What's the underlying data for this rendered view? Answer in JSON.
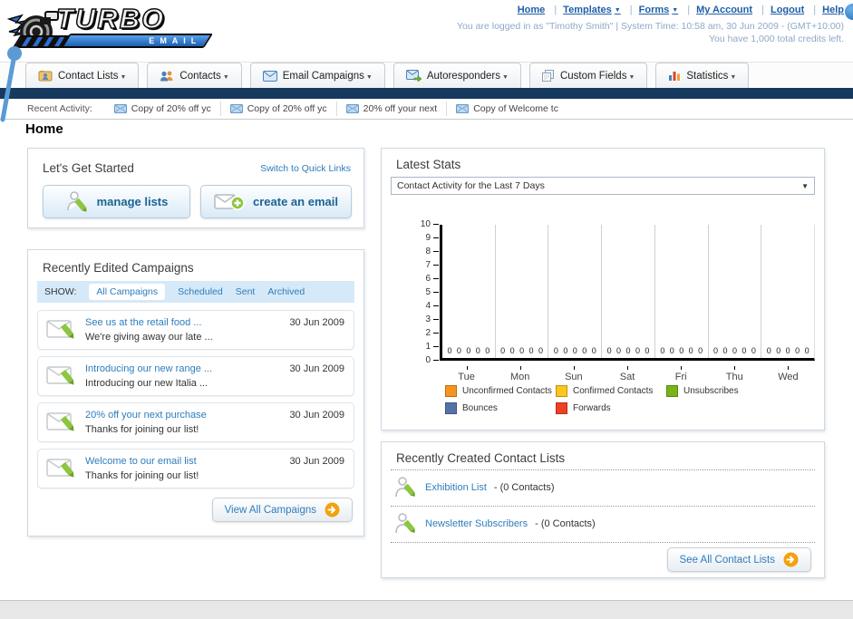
{
  "header": {
    "logo_title": "TURBO",
    "logo_subtitle": "EMAIL",
    "nav": [
      {
        "label": "Home"
      },
      {
        "label": "Templates"
      },
      {
        "label": "Forms"
      },
      {
        "label": "My Account"
      },
      {
        "label": "Logout"
      },
      {
        "label": "Help"
      }
    ],
    "login_line1": "You are logged in as \"Timothy Smith\" | System Time: 10:58 am, 30 Jun 2009 - (GMT+10:00)",
    "login_line2": "You have 1,000 total credits left."
  },
  "tabs": [
    {
      "label": "Contact Lists"
    },
    {
      "label": "Contacts"
    },
    {
      "label": "Email Campaigns"
    },
    {
      "label": "Autoresponders"
    },
    {
      "label": "Custom Fields"
    },
    {
      "label": "Statistics"
    }
  ],
  "recent_activity": {
    "label": "Recent Activity:",
    "items": [
      "Copy of 20% off yc",
      "Copy of 20% off yc",
      "20% off your next",
      "Copy of Welcome tc"
    ]
  },
  "page_title": "Home",
  "get_started": {
    "title": "Let's Get Started",
    "switch_link": "Switch to Quick Links",
    "manage_lists_label": "manage lists",
    "create_email_label": "create an email"
  },
  "campaigns": {
    "title": "Recently Edited Campaigns",
    "show_label": "SHOW:",
    "filters": [
      "All Campaigns",
      "Scheduled",
      "Sent",
      "Archived"
    ],
    "active_filter": "All Campaigns",
    "items": [
      {
        "title": "See us at the retail food ...",
        "subtitle": "We're giving away our late ...",
        "date": "30 Jun 2009"
      },
      {
        "title": "Introducing our new range ...",
        "subtitle": "Introducing our new Italia ...",
        "date": "30 Jun 2009"
      },
      {
        "title": "20% off your next purchase",
        "subtitle": "Thanks for joining our list!",
        "date": "30 Jun 2009"
      },
      {
        "title": "Welcome to our email list",
        "subtitle": "Thanks for joining our list!",
        "date": "30 Jun 2009"
      }
    ],
    "view_all_label": "View All Campaigns"
  },
  "stats": {
    "title": "Latest Stats",
    "dropdown_value": "Contact Activity for the Last 7 Days"
  },
  "chart_data": {
    "type": "bar",
    "title": "Contact Activity for the Last 7 Days",
    "categories": [
      "Tue",
      "Mon",
      "Sun",
      "Sat",
      "Fri",
      "Thu",
      "Wed"
    ],
    "series": [
      {
        "name": "Unconfirmed Contacts",
        "color": "#f7941d",
        "values": [
          0,
          0,
          0,
          0,
          0,
          0,
          0
        ]
      },
      {
        "name": "Confirmed Contacts",
        "color": "#fcc61d",
        "values": [
          0,
          0,
          0,
          0,
          0,
          0,
          0
        ]
      },
      {
        "name": "Unsubscribes",
        "color": "#7ab318",
        "values": [
          0,
          0,
          0,
          0,
          0,
          0,
          0
        ]
      },
      {
        "name": "Bounces",
        "color": "#5572a7",
        "values": [
          0,
          0,
          0,
          0,
          0,
          0,
          0
        ]
      },
      {
        "name": "Forwards",
        "color": "#ee4023",
        "values": [
          0,
          0,
          0,
          0,
          0,
          0,
          0
        ]
      }
    ],
    "ylim": [
      0,
      10
    ],
    "yticks": [
      0,
      1,
      2,
      3,
      4,
      5,
      6,
      7,
      8,
      9,
      10
    ],
    "grid": "vertical",
    "legend_position": "bottom",
    "xlabel": "",
    "ylabel": ""
  },
  "contact_lists": {
    "title": "Recently Created Contact Lists",
    "items": [
      {
        "name": "Exhibition List",
        "count": "- (0 Contacts)"
      },
      {
        "name": "Newsletter Subscribers",
        "count": "- (0 Contacts)"
      }
    ],
    "see_all_label": "See All Contact Lists"
  },
  "colors": {
    "navy_bar": "#16395e",
    "link_blue": "#2d7dbd",
    "button_text_blue": "#1b6394",
    "orange_arrow": "#f2a20d",
    "pencil_green": "#8dc63f",
    "show_bar_bg": "#d6e9f8"
  }
}
